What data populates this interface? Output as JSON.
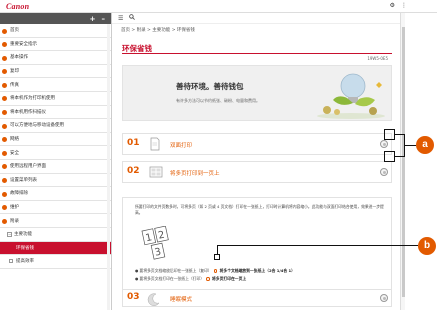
{
  "app": {
    "logo": "Canon"
  },
  "topbar": {
    "icons": [
      "gear-icon",
      "menu-icon"
    ]
  },
  "sidebar": {
    "header_icons": [
      "+",
      "–"
    ],
    "items": [
      {
        "label": "首页",
        "dot": true
      },
      {
        "label": "重要安全指示",
        "dot": true
      },
      {
        "label": "基本操作",
        "dot": true
      },
      {
        "label": "复印",
        "dot": true
      },
      {
        "label": "传真",
        "dot": true
      },
      {
        "label": "将本机作为打印机使用",
        "dot": true
      },
      {
        "label": "将本机用作扫描仪",
        "dot": true
      },
      {
        "label": "可以方便地与移动设备使用",
        "dot": true
      },
      {
        "label": "网络",
        "dot": true
      },
      {
        "label": "安全",
        "dot": true
      },
      {
        "label": "使用远程用户界面",
        "dot": true
      },
      {
        "label": "设置菜单列表",
        "dot": true
      },
      {
        "label": "故障排除",
        "dot": true
      },
      {
        "label": "维护",
        "dot": true
      },
      {
        "label": "附录",
        "dot": true
      },
      {
        "label": "主要功能",
        "dot": false,
        "kind": "group"
      },
      {
        "label": "环保省钱",
        "dot": false,
        "kind": "active"
      },
      {
        "label": "提高效率",
        "dot": false,
        "kind": "sub"
      }
    ]
  },
  "toolbar": {
    "icons": [
      "menu-icon",
      "search-icon"
    ]
  },
  "breadcrumb": "首页 > 附录 > 主要功能 > 环保省钱",
  "page": {
    "title": "环保省钱",
    "doc_code": "19W5-0E5",
    "hero_title": "善待环境。善待钱包",
    "hero_sub": "有许多方法可以节约纸张、碳粉、电量和费用。"
  },
  "rows": [
    {
      "num": "01",
      "label": "双面打印",
      "icon": "duplex-icon"
    },
    {
      "num": "02",
      "label": "将多页打印到一页上",
      "icon": "nup-icon"
    },
    {
      "num": "03",
      "label": "睡眠模式",
      "icon": "moon-icon"
    }
  ],
  "detail": {
    "text": "所要打印的文件页数多时，可将多页（如 2 页或 4 页文档）打印在一张纸上，打印时计算机将内容缩小。此功能与双面打印结合使用，效果进一步提高。",
    "bullet1_a": "要将多页文档缩放后印在一张纸上（复印）",
    "bullet1_b": "将多个文档缩放到一张纸上（2合 1/4合 1）",
    "bullet2_a": "要将多页文档打印在一张纸上（打印）",
    "bullet2_b": "将多页打印在一页上"
  },
  "callouts": {
    "a": "a",
    "b": "b"
  },
  "colors": {
    "brand": "#c8102e",
    "accent": "#e25a00"
  }
}
